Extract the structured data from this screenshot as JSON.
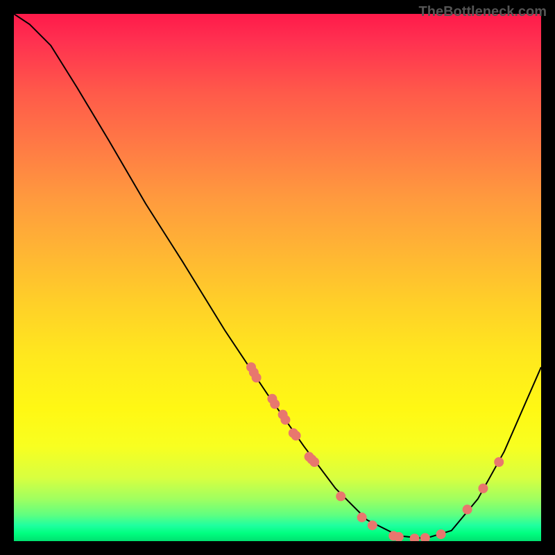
{
  "watermark": "TheBottleneck.com",
  "chart_data": {
    "type": "line",
    "title": "",
    "xlabel": "",
    "ylabel": "",
    "xlim": [
      0,
      100
    ],
    "ylim": [
      0,
      100
    ],
    "curve": [
      {
        "x": 0,
        "y": 100
      },
      {
        "x": 3,
        "y": 98
      },
      {
        "x": 7,
        "y": 94
      },
      {
        "x": 12,
        "y": 86
      },
      {
        "x": 18,
        "y": 76
      },
      {
        "x": 25,
        "y": 64
      },
      {
        "x": 32,
        "y": 53
      },
      {
        "x": 40,
        "y": 40
      },
      {
        "x": 48,
        "y": 28
      },
      {
        "x": 55,
        "y": 18
      },
      {
        "x": 61,
        "y": 10
      },
      {
        "x": 67,
        "y": 4
      },
      {
        "x": 73,
        "y": 1
      },
      {
        "x": 78,
        "y": 0.5
      },
      {
        "x": 83,
        "y": 2
      },
      {
        "x": 88,
        "y": 8
      },
      {
        "x": 93,
        "y": 17
      },
      {
        "x": 100,
        "y": 33
      }
    ],
    "markers": [
      {
        "x": 45,
        "y": 33
      },
      {
        "x": 45.5,
        "y": 32
      },
      {
        "x": 46,
        "y": 31
      },
      {
        "x": 49,
        "y": 27
      },
      {
        "x": 49.5,
        "y": 26
      },
      {
        "x": 51,
        "y": 24
      },
      {
        "x": 51.5,
        "y": 23
      },
      {
        "x": 53,
        "y": 20.5
      },
      {
        "x": 53.5,
        "y": 20
      },
      {
        "x": 56,
        "y": 16
      },
      {
        "x": 56.5,
        "y": 15.5
      },
      {
        "x": 57,
        "y": 15
      },
      {
        "x": 62,
        "y": 8.5
      },
      {
        "x": 66,
        "y": 4.5
      },
      {
        "x": 68,
        "y": 3
      },
      {
        "x": 72,
        "y": 1
      },
      {
        "x": 73,
        "y": 0.8
      },
      {
        "x": 76,
        "y": 0.5
      },
      {
        "x": 78,
        "y": 0.6
      },
      {
        "x": 81,
        "y": 1.3
      },
      {
        "x": 86,
        "y": 6
      },
      {
        "x": 89,
        "y": 10
      },
      {
        "x": 92,
        "y": 15
      }
    ],
    "marker_color": "#e8776e",
    "curve_color": "#000000"
  }
}
